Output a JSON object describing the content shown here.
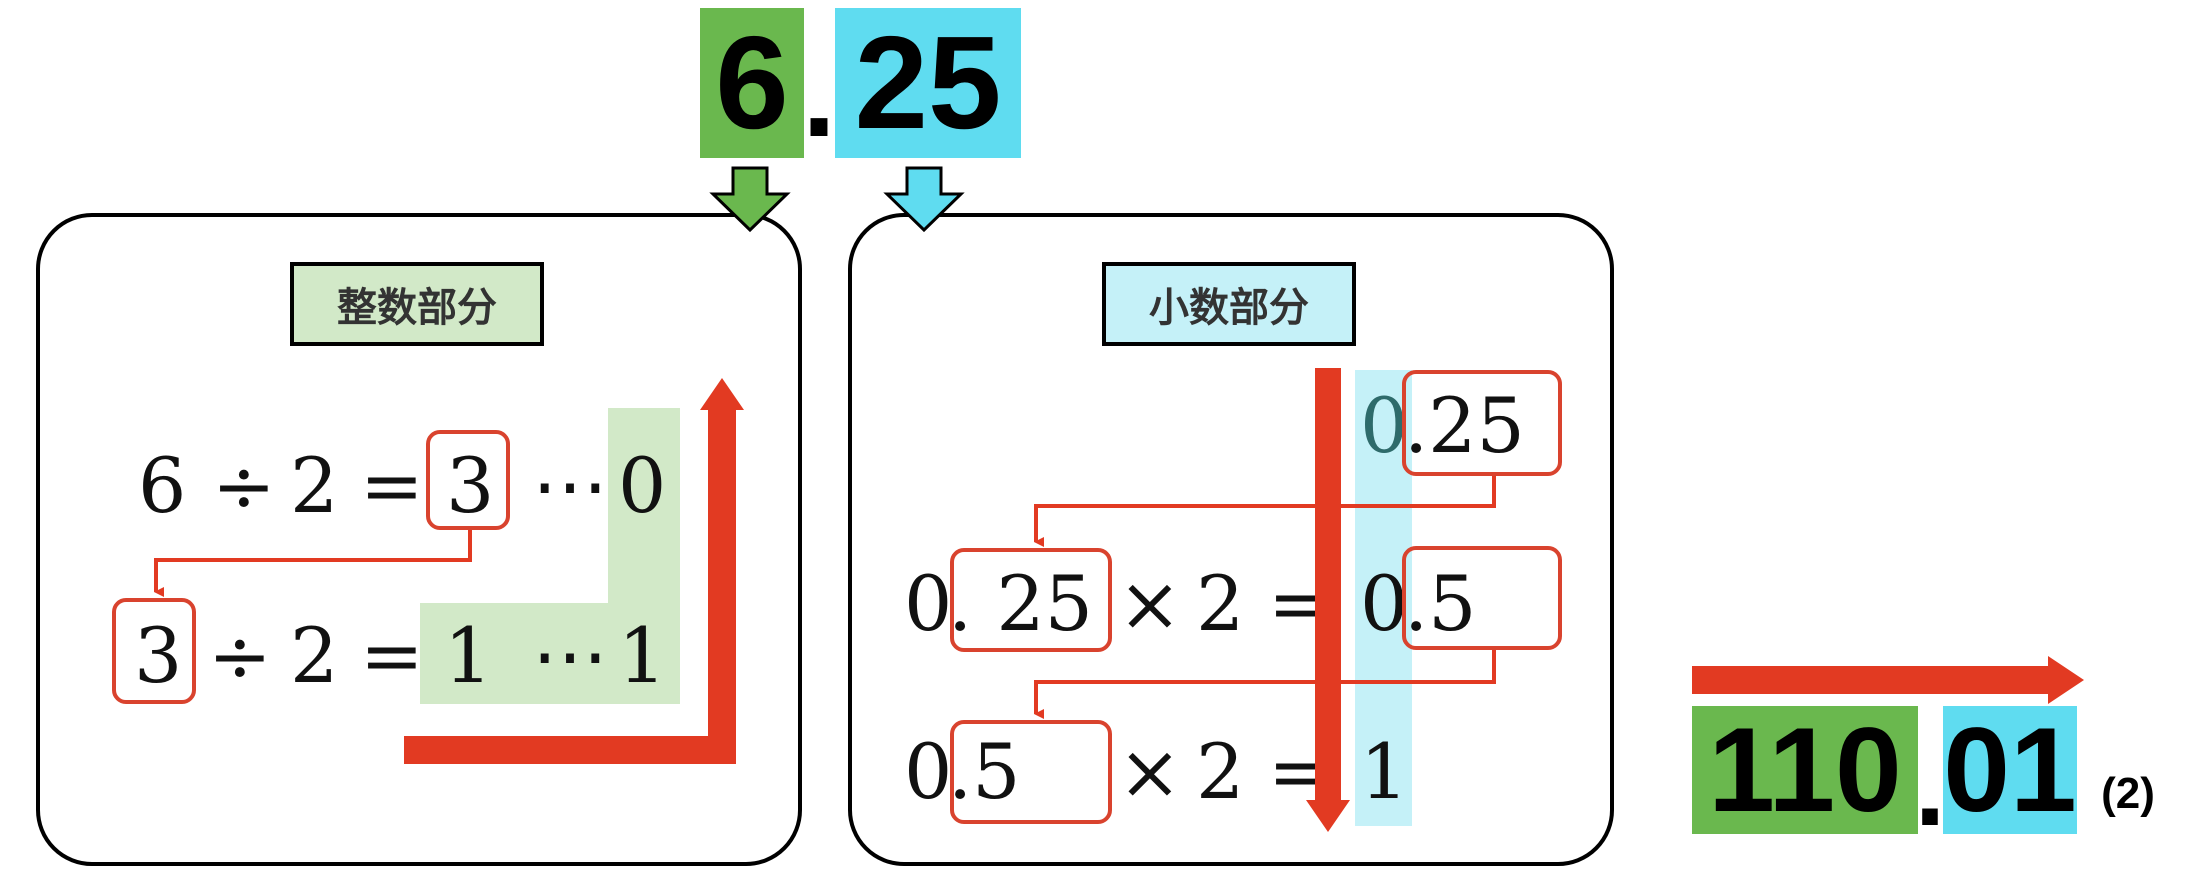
{
  "header": {
    "integer_digit": "6",
    "point": ".",
    "fraction_digits": "25"
  },
  "integer_panel": {
    "title": "整数部分",
    "row1": {
      "dividend": "6",
      "op": "÷",
      "divisor": "2",
      "eq": "=",
      "quotient": "3",
      "dots": "⋯",
      "remainder": "0"
    },
    "row2": {
      "dividend": "3",
      "op": "÷",
      "divisor": "2",
      "eq": "=",
      "quotient": "1",
      "dots": "⋯",
      "remainder": "1"
    }
  },
  "fraction_panel": {
    "title": "小数部分",
    "start": {
      "int": "0",
      "frac": ".25"
    },
    "row1": {
      "int": "0",
      "frac": ". 25",
      "op": "×",
      "mult": "2",
      "eq": "=",
      "res_int": "0",
      "res_frac": ".5"
    },
    "row2": {
      "int": "0",
      "frac": ".5",
      "op": "×",
      "mult": "2",
      "eq": "=",
      "res_int": "1"
    }
  },
  "result": {
    "integer_part": "110",
    "point": ".",
    "fraction_part": "01",
    "base": "(2)"
  },
  "colors": {
    "green": "#6ab84e",
    "cyan": "#5fdcf0",
    "light_green": "#d2e9c8",
    "light_cyan": "#c5f1f8",
    "red": "#e23a22"
  }
}
